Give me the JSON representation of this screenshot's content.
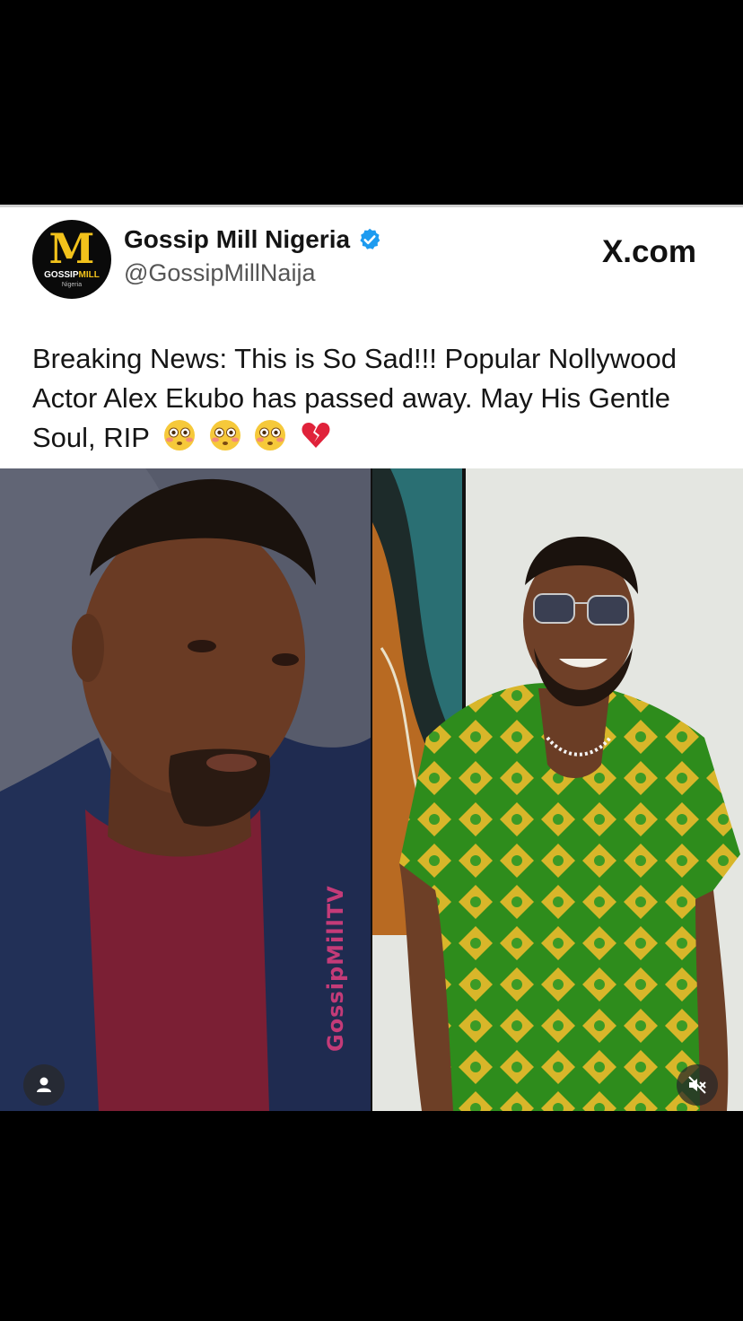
{
  "tweet": {
    "account_name": "Gossip Mill Nigeria",
    "handle": "@GossipMillNaija",
    "source": "X.com",
    "text": "Breaking News: This is So Sad!!! Popular Nollywood Actor Alex Ekubo has passed away. May His Gentle Soul, RIP",
    "emojis": [
      "😳",
      "😳",
      "😳",
      "💔"
    ],
    "verified_color": "#1d9bf0"
  },
  "avatar": {
    "letter": "M",
    "brand_prefix": "GOSSIP",
    "brand_suffix": "MILL",
    "brand_sub": "Nigeria"
  },
  "media": {
    "watermark": "GossipMillTV",
    "left_photo": "man-in-navy-blazer-photo",
    "right_photo": "man-in-green-patterned-shirt-photo"
  }
}
